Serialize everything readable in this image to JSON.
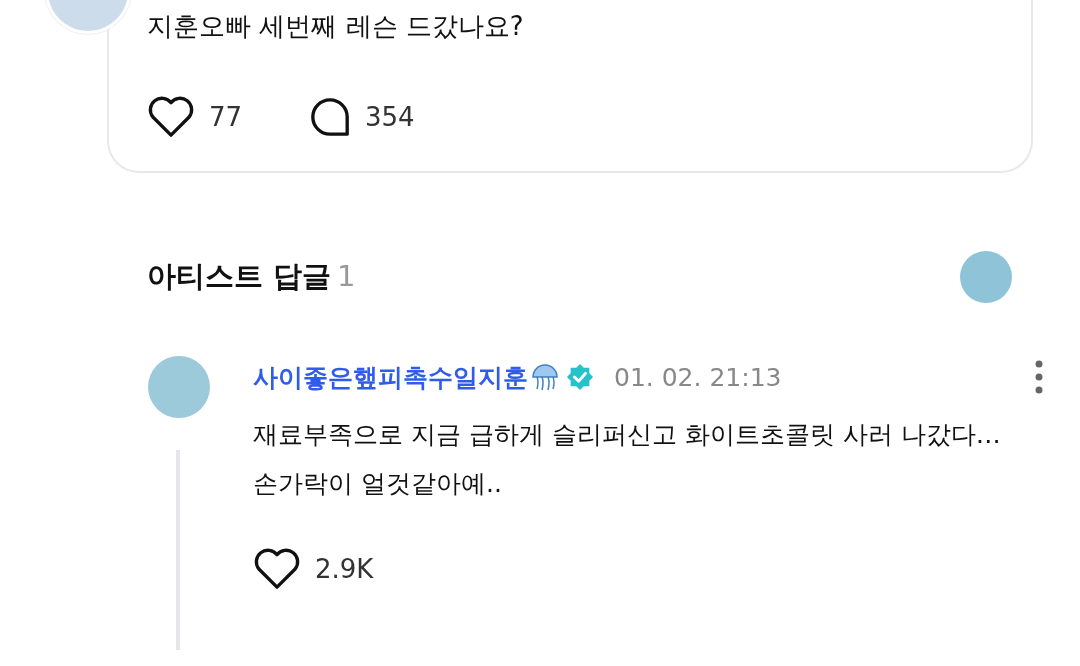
{
  "post": {
    "text": "지훈오빠 세번째 레슨 드갔나요?",
    "likes": "77",
    "comments": "354"
  },
  "artist_replies": {
    "title": "아티스트 답글",
    "count": "1",
    "replies": [
      {
        "author": "사이좋은햎피촉수일지훈",
        "verified": true,
        "time": "01. 02. 21:13",
        "text": "재료부족으로 지금 급하게 슬리퍼신고 화이트초콜릿 사러 나갔다…\n손가락이 얼것같아예..",
        "likes": "2.9K"
      }
    ]
  }
}
